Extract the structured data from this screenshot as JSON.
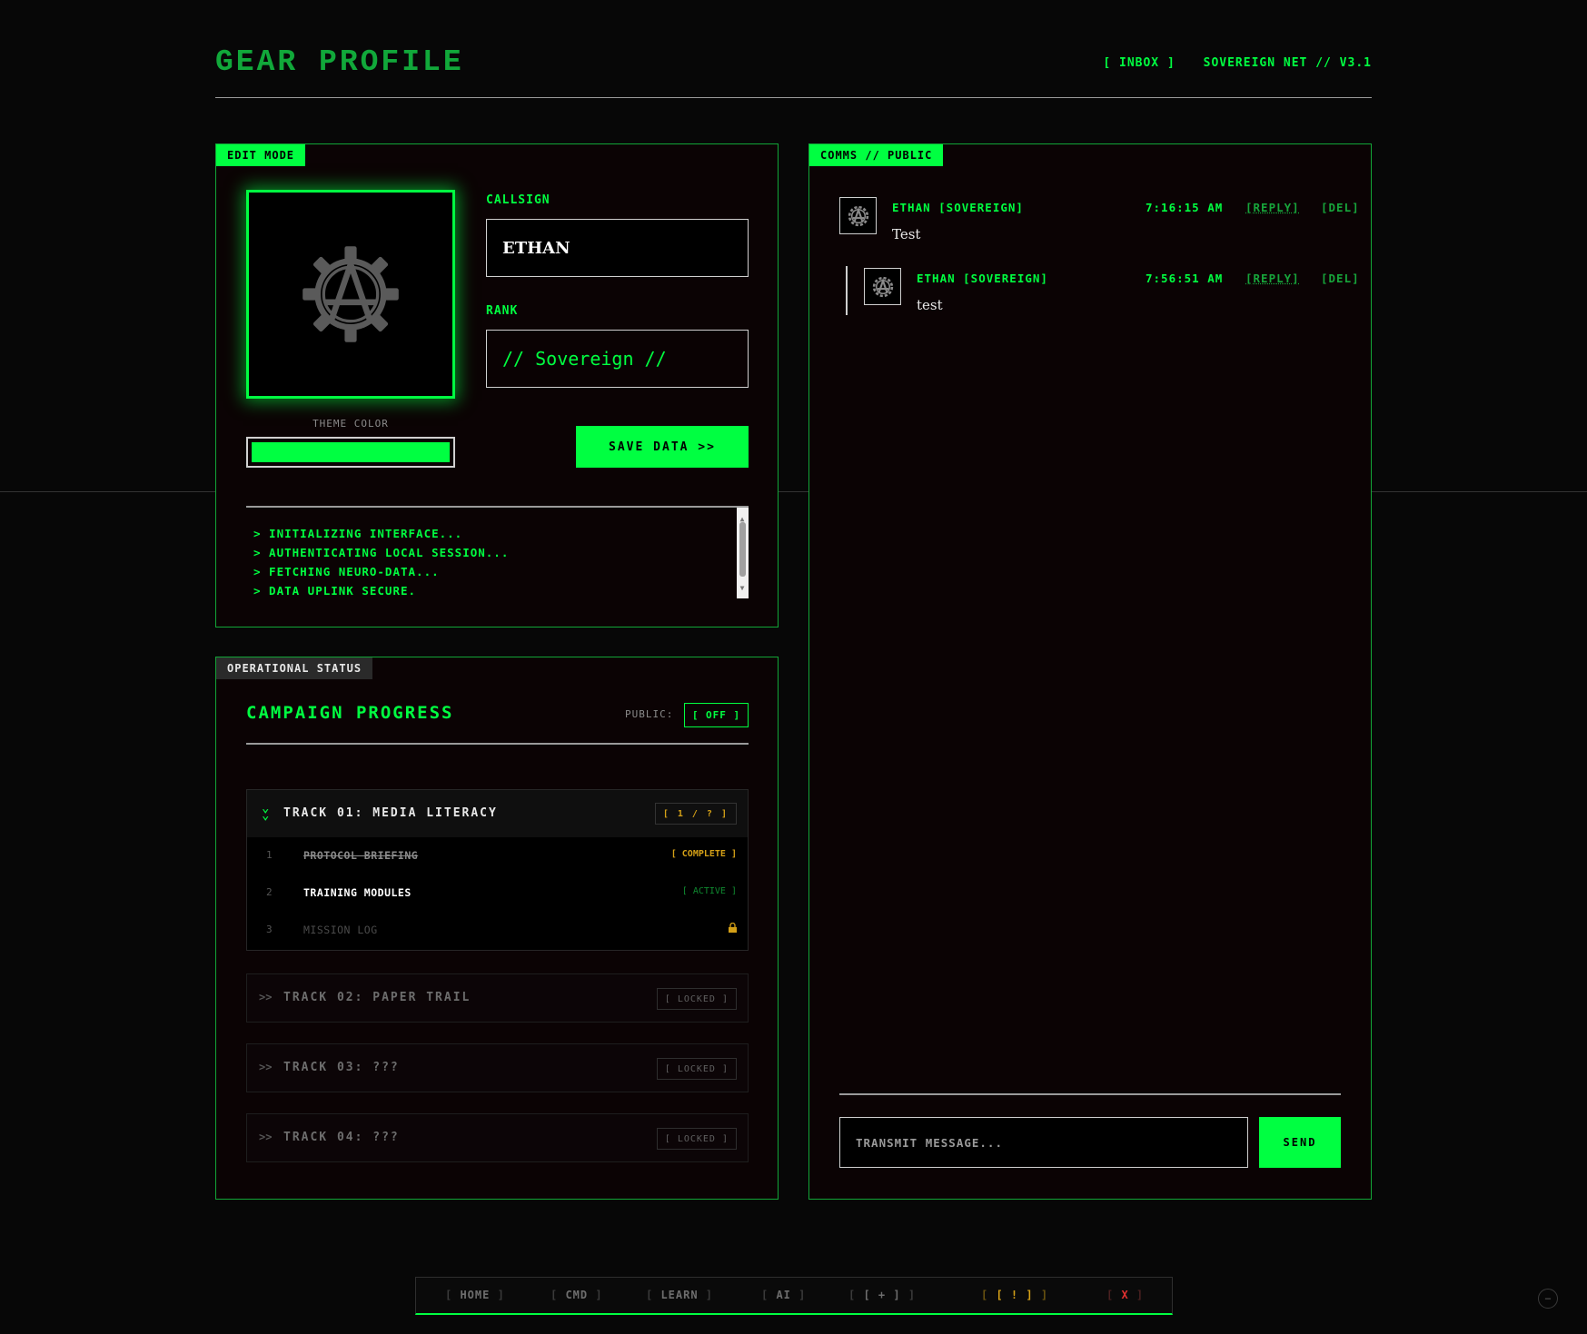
{
  "header": {
    "title": "GEAR PROFILE",
    "inbox_label": "[ INBOX ]",
    "net_label": "SOVEREIGN NET // V3.1"
  },
  "edit_panel": {
    "tag": "EDIT MODE",
    "avatar_icon": "anarchy-gear-icon",
    "theme_label": "THEME COLOR",
    "theme_color": "#00ff41",
    "callsign_label": "CALLSIGN",
    "callsign_value": "ETHAN",
    "rank_label": "RANK",
    "rank_value": "// Sovereign //",
    "save_label": "SAVE DATA >>",
    "log": [
      "> INITIALIZING INTERFACE...",
      "> AUTHENTICATING LOCAL SESSION...",
      "> FETCHING NEURO-DATA...",
      "> DATA UPLINK SECURE."
    ]
  },
  "status_panel": {
    "tag": "OPERATIONAL STATUS",
    "title": "CAMPAIGN PROGRESS",
    "public_label": "PUBLIC:",
    "public_value": "[ OFF ]",
    "track1": {
      "name": "TRACK 01: MEDIA LITERACY",
      "count": "[ 1 / ? ]",
      "items": [
        {
          "num": "1",
          "name": "PROTOCOL BRIEFING",
          "status": "[ COMPLETE ]"
        },
        {
          "num": "2",
          "name": "TRAINING MODULES",
          "status": "[ ACTIVE ]"
        },
        {
          "num": "3",
          "name": "MISSION LOG",
          "status": "lock-icon"
        }
      ]
    },
    "locked_tracks": [
      {
        "arrow": ">>",
        "name": "TRACK 02: PAPER TRAIL",
        "status": "[ LOCKED ]"
      },
      {
        "arrow": ">>",
        "name": "TRACK 03: ???",
        "status": "[ LOCKED ]"
      },
      {
        "arrow": ">>",
        "name": "TRACK 04: ???",
        "status": "[ LOCKED ]"
      }
    ]
  },
  "comms_panel": {
    "tag": "COMMS // PUBLIC",
    "messages": [
      {
        "author": "ETHAN [SOVEREIGN]",
        "time": "7:16:15 AM",
        "reply": "[REPLY]",
        "del": "[DEL]",
        "text": "Test"
      },
      {
        "author": "ETHAN [SOVEREIGN]",
        "time": "7:56:51 AM",
        "reply": "[REPLY]",
        "del": "[DEL]",
        "text": "test"
      }
    ],
    "input_placeholder": "TRANSMIT MESSAGE...",
    "send_label": "SEND"
  },
  "bottom_nav": {
    "home": "HOME",
    "cmd": "CMD",
    "learn": "LEARN",
    "ai": "AI",
    "plus": "+",
    "alert": "!",
    "close": "X"
  },
  "colors": {
    "accent": "#00ff41",
    "accent_dim": "#11a83a",
    "alert": "#d4a017",
    "danger": "#e23030"
  }
}
